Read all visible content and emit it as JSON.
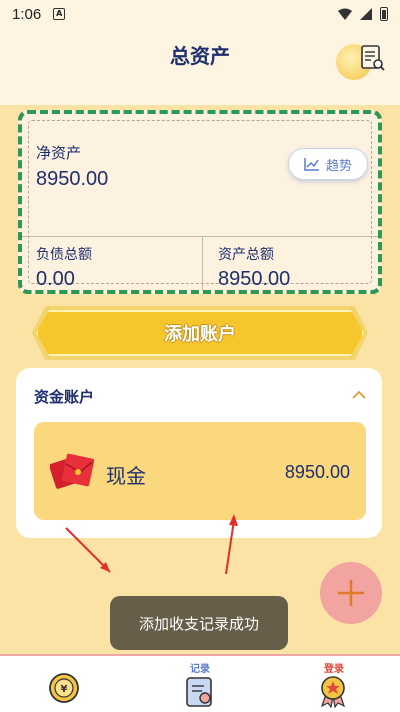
{
  "status": {
    "time": "1:06",
    "notif_letter": "A"
  },
  "header": {
    "title": "总资产"
  },
  "net_assets": {
    "label": "净资产",
    "value": "8950.00",
    "trend_label": "趋势",
    "liabilities_label": "负债总额",
    "liabilities_value": "0.00",
    "assets_label": "资产总额",
    "assets_value": "8950.00"
  },
  "add_account_label": "添加账户",
  "accounts": {
    "title": "资金账户",
    "items": [
      {
        "name": "现金",
        "amount": "8950.00"
      }
    ]
  },
  "toast": "添加收支记录成功",
  "tabs": [
    {
      "label": "",
      "icon": "coin-icon"
    },
    {
      "label": "记录",
      "icon": "record-icon"
    },
    {
      "label": "登录",
      "icon": "medal-icon"
    }
  ],
  "colors": {
    "accent_blue": "#1e2f6e",
    "button_yellow": "#f6c62c",
    "fab_pink": "#f1a4a0",
    "arrow_red": "#e0302a"
  }
}
